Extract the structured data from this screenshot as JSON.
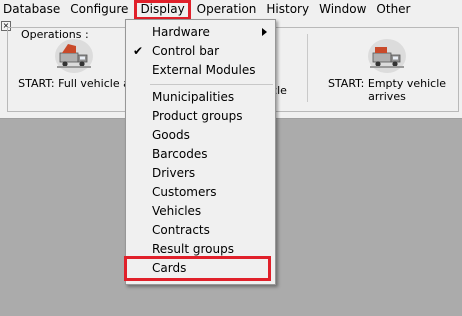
{
  "menubar": {
    "items": [
      "Database",
      "Configure",
      "Display",
      "Operation",
      "History",
      "Window",
      "Other"
    ]
  },
  "operations": {
    "group_label": "Operations :",
    "close_glyph": "×",
    "buttons": [
      {
        "label_line1": "START:  Full vehicle a",
        "label_line2": ""
      },
      {
        "label_line1": "cle",
        "label_line2": ""
      },
      {
        "label_line1": "START:  Empty vehicle",
        "label_line2": "arrives"
      }
    ]
  },
  "display_menu": {
    "items": [
      {
        "label": "Hardware",
        "has_submenu": true,
        "checked": false
      },
      {
        "label": "Control bar",
        "has_submenu": false,
        "checked": true
      },
      {
        "label": "External Modules",
        "has_submenu": false,
        "checked": false
      },
      {
        "label": "Municipalities",
        "has_submenu": false,
        "checked": false
      },
      {
        "label": "Product groups",
        "has_submenu": false,
        "checked": false
      },
      {
        "label": "Goods",
        "has_submenu": false,
        "checked": false
      },
      {
        "label": "Barcodes",
        "has_submenu": false,
        "checked": false
      },
      {
        "label": "Drivers",
        "has_submenu": false,
        "checked": false
      },
      {
        "label": "Customers",
        "has_submenu": false,
        "checked": false
      },
      {
        "label": "Vehicles",
        "has_submenu": false,
        "checked": false
      },
      {
        "label": "Contracts",
        "has_submenu": false,
        "checked": false
      },
      {
        "label": "Result groups",
        "has_submenu": false,
        "checked": false
      },
      {
        "label": "Cards",
        "has_submenu": false,
        "checked": false
      }
    ],
    "check_glyph": "✔",
    "highlight_color": "#e0202a"
  }
}
